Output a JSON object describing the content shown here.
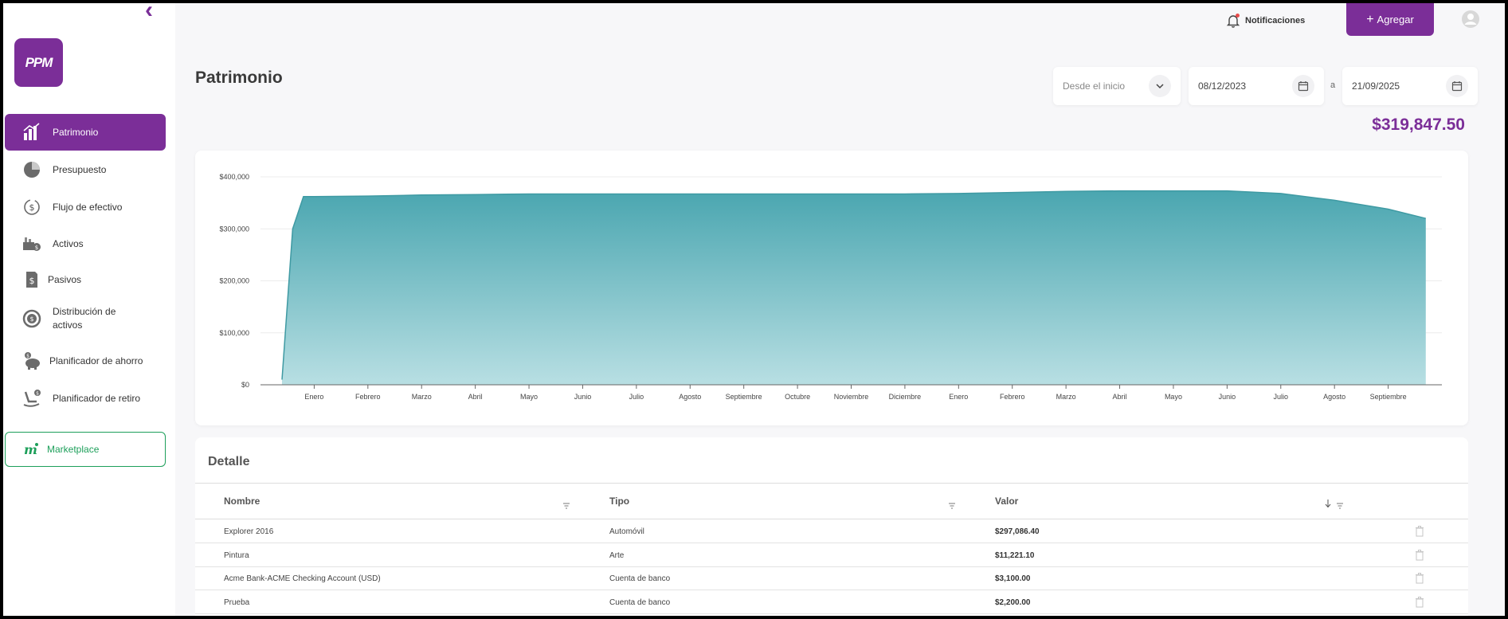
{
  "app": {
    "logo_text": "PPM"
  },
  "sidebar": {
    "items": [
      {
        "label": "Patrimonio",
        "icon": "bar-chart-icon",
        "active": true
      },
      {
        "label": "Presupuesto",
        "icon": "pie-chart-icon",
        "active": false
      },
      {
        "label": "Flujo de efectivo",
        "icon": "cash-flow-icon",
        "active": false
      },
      {
        "label": "Activos",
        "icon": "assets-icon",
        "active": false
      },
      {
        "label": "Pasivos",
        "icon": "liabilities-icon",
        "active": false
      },
      {
        "label": "Distribución de activos",
        "icon": "distribution-icon",
        "active": false
      },
      {
        "label": "Planificador de ahorro",
        "icon": "piggy-bank-icon",
        "active": false
      },
      {
        "label": "Planificador de retiro",
        "icon": "rocking-chair-icon",
        "active": false
      }
    ],
    "marketplace_label": "Marketplace"
  },
  "topbar": {
    "notifications_label": "Notificaciones",
    "add_label": "Agregar"
  },
  "header": {
    "title": "Patrimonio",
    "range_select": "Desde el inicio",
    "date_from": "08/12/2023",
    "date_separator": "a",
    "date_to": "21/09/2025",
    "total": "$319,847.50"
  },
  "chart_data": {
    "type": "area",
    "y_ticks": [
      "$0",
      "$100,000",
      "$200,000",
      "$300,000",
      "$400,000"
    ],
    "ylim": [
      0,
      400000
    ],
    "categories": [
      "Enero",
      "Febrero",
      "Marzo",
      "Abril",
      "Mayo",
      "Junio",
      "Julio",
      "Agosto",
      "Septiembre",
      "Octubre",
      "Noviembre",
      "Diciembre",
      "Enero",
      "Febrero",
      "Marzo",
      "Abril",
      "Mayo",
      "Junio",
      "Julio",
      "Agosto",
      "Septiembre"
    ],
    "x": [
      -0.6,
      -0.4,
      -0.2,
      0,
      1,
      2,
      3,
      4,
      5,
      6,
      7,
      8,
      9,
      10,
      11,
      12,
      13,
      14,
      15,
      16,
      17,
      18,
      19,
      20,
      20.7
    ],
    "values": [
      10000,
      300000,
      362000,
      362000,
      363000,
      365000,
      366000,
      367000,
      367000,
      367000,
      367000,
      367000,
      367000,
      367000,
      367000,
      368000,
      370000,
      372000,
      373000,
      373000,
      373000,
      368000,
      355000,
      338000,
      320000
    ],
    "colors": {
      "fill_top": "#4aa6b0",
      "fill_bottom": "#b8dfe3",
      "line": "#3f9aa3"
    },
    "grid": true
  },
  "detail": {
    "title": "Detalle",
    "columns": [
      "Nombre",
      "Tipo",
      "Valor"
    ],
    "rows": [
      {
        "name": "Explorer 2016",
        "type": "Automóvil",
        "value": "$297,086.40"
      },
      {
        "name": "Pintura",
        "type": "Arte",
        "value": "$11,221.10"
      },
      {
        "name": "Acme Bank-ACME Checking Account (USD)",
        "type": "Cuenta de banco",
        "value": "$3,100.00"
      },
      {
        "name": "Prueba",
        "type": "Cuenta de banco",
        "value": "$2,200.00"
      }
    ]
  }
}
